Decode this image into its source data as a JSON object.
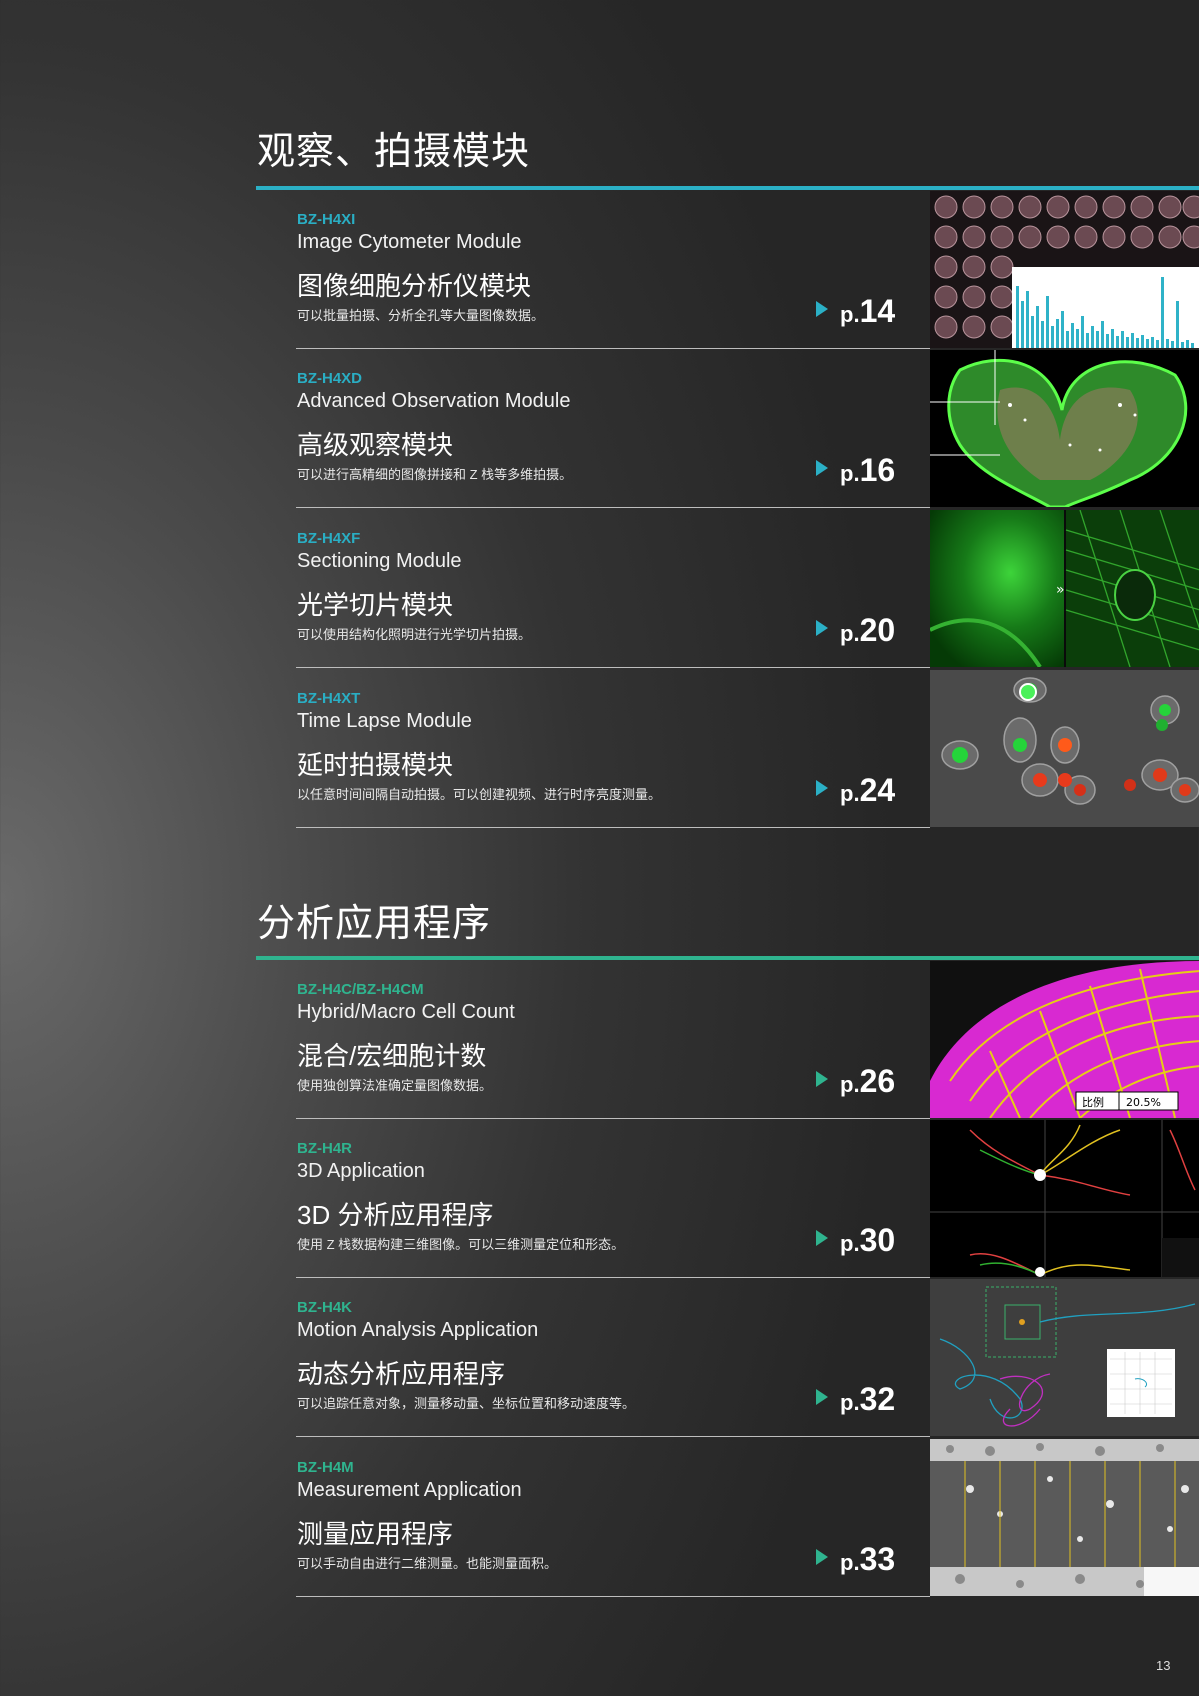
{
  "sections": [
    {
      "title": "观察、拍摄模块",
      "items": [
        {
          "code": "BZ-H4XI",
          "en": "Image Cytometer Module",
          "zh": "图像细胞分析仪模块",
          "desc": "可以批量拍摄、分析全孔等大量图像数据。",
          "page_prefix": "p.",
          "page": "14"
        },
        {
          "code": "BZ-H4XD",
          "en": "Advanced Observation Module",
          "zh": "高级观察模块",
          "desc": "可以进行高精细的图像拼接和 Z 栈等多维拍摄。",
          "page_prefix": "p.",
          "page": "16"
        },
        {
          "code": "BZ-H4XF",
          "en": "Sectioning Module",
          "zh": "光学切片模块",
          "desc": "可以使用结构化照明进行光学切片拍摄。",
          "page_prefix": "p.",
          "page": "20"
        },
        {
          "code": "BZ-H4XT",
          "en": "Time Lapse Module",
          "zh": "延时拍摄模块",
          "desc": "以任意时间间隔自动拍摄。可以创建视频、进行时序亮度测量。",
          "page_prefix": "p.",
          "page": "24"
        }
      ]
    },
    {
      "title": "分析应用程序",
      "items": [
        {
          "code": "BZ-H4C/BZ-H4CM",
          "en": "Hybrid/Macro Cell Count",
          "zh": "混合/宏细胞计数",
          "desc": "使用独创算法准确定量图像数据。",
          "page_prefix": "p.",
          "page": "26",
          "overlay_label": "比例",
          "overlay_value": "20.5%"
        },
        {
          "code": "BZ-H4R",
          "en": "3D Application",
          "zh": "3D 分析应用程序",
          "desc": "使用 Z 栈数据构建三维图像。可以三维测量定位和形态。",
          "page_prefix": "p.",
          "page": "30"
        },
        {
          "code": "BZ-H4K",
          "en": "Motion Analysis Application",
          "zh": "动态分析应用程序",
          "desc": "可以追踪任意对象，测量移动量、坐标位置和移动速度等。",
          "page_prefix": "p.",
          "page": "32"
        },
        {
          "code": "BZ-H4M",
          "en": "Measurement Application",
          "zh": "测量应用程序",
          "desc": "可以手动自由进行二维测量。也能测量面积。",
          "page_prefix": "p.",
          "page": "33"
        }
      ]
    }
  ],
  "page_number": "13",
  "colors": {
    "section1_accent": "#2bb0c6",
    "section2_accent": "#2fb48f"
  }
}
